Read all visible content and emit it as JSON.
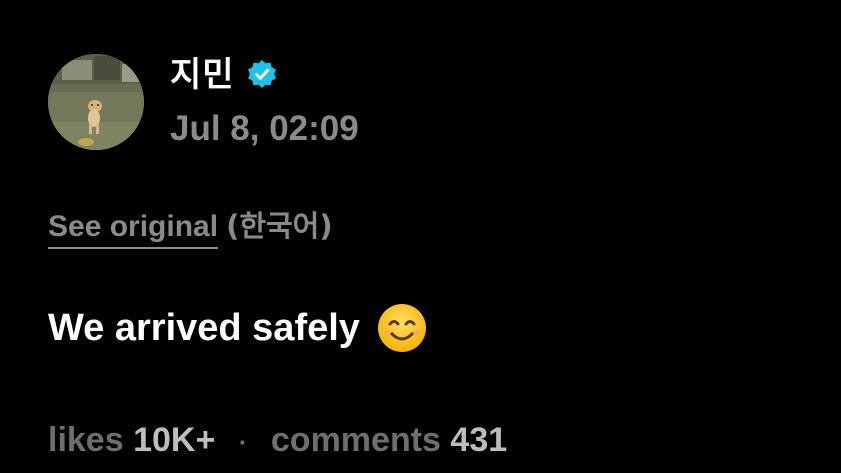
{
  "post": {
    "author": {
      "name": "지민",
      "verified": true,
      "verified_color": "#1dc3e6",
      "avatar_icon": "puppy-on-grass-avatar"
    },
    "timestamp": "Jul 8, 02:09",
    "translation": {
      "see_original_label": "See original",
      "language_label": "(한국어)"
    },
    "text": "We arrived safely",
    "emoji_icon": "smiling-face-with-smiling-eyes",
    "stats": {
      "likes_label": "likes",
      "likes_value": "10K+",
      "separator": "·",
      "comments_label": "comments",
      "comments_value": "431"
    }
  },
  "colors": {
    "background": "#000000",
    "primary_text": "#ffffff",
    "secondary_text": "#8a8a8a"
  }
}
